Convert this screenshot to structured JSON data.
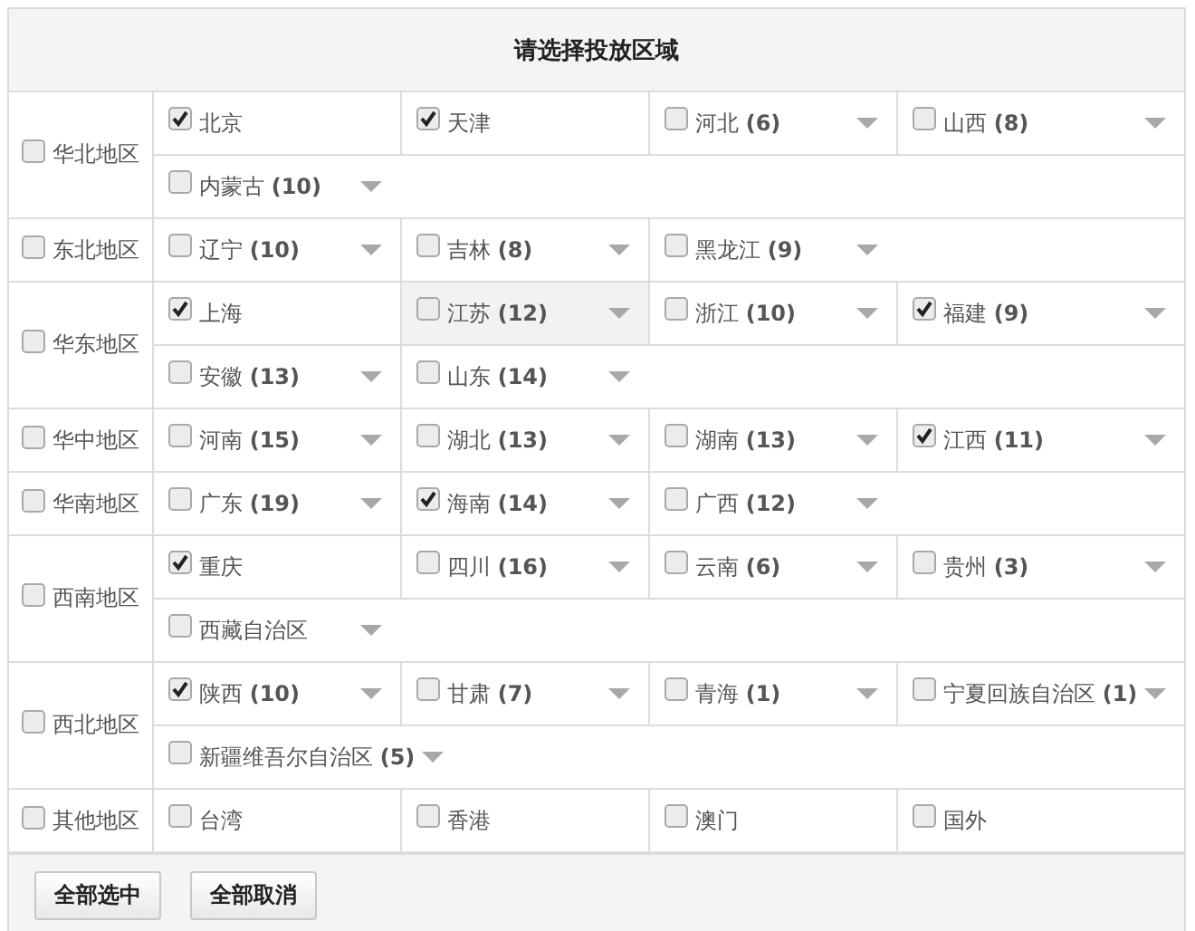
{
  "title": "请选择投放区域",
  "regions": [
    {
      "label": "华北地区",
      "checked": false,
      "provinces": [
        {
          "label": "北京",
          "checked": true,
          "expandable": false,
          "highlighted": false
        },
        {
          "label": "天津",
          "checked": true,
          "expandable": false,
          "highlighted": false
        },
        {
          "label": "河北 **(6)**",
          "checked": false,
          "expandable": true,
          "highlighted": false
        },
        {
          "label": "山西 **(8)**",
          "checked": false,
          "expandable": true,
          "highlighted": false
        },
        {
          "label": "内蒙古 **(10)**",
          "checked": false,
          "expandable": true,
          "highlighted": false
        }
      ]
    },
    {
      "label": "东北地区",
      "checked": false,
      "provinces": [
        {
          "label": "辽宁 **(10)**",
          "checked": false,
          "expandable": true,
          "highlighted": false
        },
        {
          "label": "吉林 **(8)**",
          "checked": false,
          "expandable": true,
          "highlighted": false
        },
        {
          "label": "黑龙江 **(9)**",
          "checked": false,
          "expandable": true,
          "highlighted": false
        }
      ]
    },
    {
      "label": "华东地区",
      "checked": false,
      "provinces": [
        {
          "label": "上海",
          "checked": true,
          "expandable": false,
          "highlighted": false
        },
        {
          "label": "江苏 **(12)**",
          "checked": false,
          "expandable": true,
          "highlighted": true
        },
        {
          "label": "浙江 **(10)**",
          "checked": false,
          "expandable": true,
          "highlighted": false
        },
        {
          "label": "福建 **(9)**",
          "checked": true,
          "expandable": true,
          "highlighted": false
        },
        {
          "label": "安徽 **(13)**",
          "checked": false,
          "expandable": true,
          "highlighted": false
        },
        {
          "label": "山东 **(14)**",
          "checked": false,
          "expandable": true,
          "highlighted": false
        }
      ]
    },
    {
      "label": "华中地区",
      "checked": false,
      "provinces": [
        {
          "label": "河南 **(15)**",
          "checked": false,
          "expandable": true,
          "highlighted": false
        },
        {
          "label": "湖北 **(13)**",
          "checked": false,
          "expandable": true,
          "highlighted": false
        },
        {
          "label": "湖南 **(13)**",
          "checked": false,
          "expandable": true,
          "highlighted": false
        },
        {
          "label": "江西 **(11)**",
          "checked": true,
          "expandable": true,
          "highlighted": false
        }
      ]
    },
    {
      "label": "华南地区",
      "checked": false,
      "provinces": [
        {
          "label": "广东 **(19)**",
          "checked": false,
          "expandable": true,
          "highlighted": false
        },
        {
          "label": "海南 **(14)**",
          "checked": true,
          "expandable": true,
          "highlighted": false
        },
        {
          "label": "广西 **(12)**",
          "checked": false,
          "expandable": true,
          "highlighted": false
        }
      ]
    },
    {
      "label": "西南地区",
      "checked": false,
      "provinces": [
        {
          "label": "重庆",
          "checked": true,
          "expandable": false,
          "highlighted": false
        },
        {
          "label": "四川 **(16)**",
          "checked": false,
          "expandable": true,
          "highlighted": false
        },
        {
          "label": "云南 **(6)**",
          "checked": false,
          "expandable": true,
          "highlighted": false
        },
        {
          "label": "贵州 **(3)**",
          "checked": false,
          "expandable": true,
          "highlighted": false
        },
        {
          "label": "西藏自治区",
          "checked": false,
          "expandable": true,
          "highlighted": false
        }
      ]
    },
    {
      "label": "西北地区",
      "checked": false,
      "provinces": [
        {
          "label": "陕西 **(10)**",
          "checked": true,
          "expandable": true,
          "highlighted": false
        },
        {
          "label": "甘肃 **(7)**",
          "checked": false,
          "expandable": true,
          "highlighted": false
        },
        {
          "label": "青海 **(1)**",
          "checked": false,
          "expandable": true,
          "highlighted": false
        },
        {
          "label": "宁夏回族自治区 **(1)**",
          "checked": false,
          "expandable": true,
          "highlighted": false
        },
        {
          "label": "新疆维吾尔自治区 **(5)**",
          "checked": false,
          "expandable": true,
          "highlighted": false
        }
      ]
    },
    {
      "label": "其他地区",
      "checked": false,
      "provinces": [
        {
          "label": "台湾",
          "checked": false,
          "expandable": false,
          "highlighted": false
        },
        {
          "label": "香港",
          "checked": false,
          "expandable": false,
          "highlighted": false
        },
        {
          "label": "澳门",
          "checked": false,
          "expandable": false,
          "highlighted": false
        },
        {
          "label": "国外",
          "checked": false,
          "expandable": false,
          "highlighted": false
        }
      ]
    }
  ],
  "buttons": [
    "全部选中",
    "全部取消"
  ]
}
